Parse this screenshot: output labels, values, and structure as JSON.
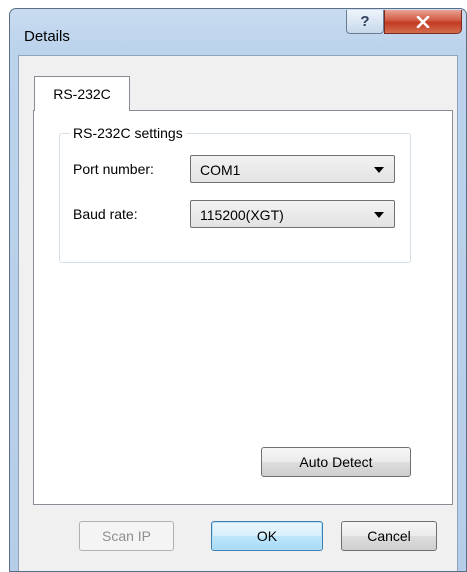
{
  "window": {
    "title": "Details"
  },
  "tabs": [
    {
      "label": "RS-232C",
      "active": true
    }
  ],
  "settings_group": {
    "title": "RS-232C settings",
    "port_label": "Port number:",
    "port_value": "COM1",
    "baud_label": "Baud rate:",
    "baud_value": "115200(XGT)"
  },
  "buttons": {
    "auto_detect": "Auto Detect",
    "scan_ip": "Scan IP",
    "ok": "OK",
    "cancel": "Cancel"
  },
  "icons": {
    "help": "help-icon",
    "close": "close-icon",
    "dropdown": "chevron-down-icon"
  },
  "colors": {
    "close_button": "#c94a33",
    "default_button_border": "#3c7fb1"
  }
}
